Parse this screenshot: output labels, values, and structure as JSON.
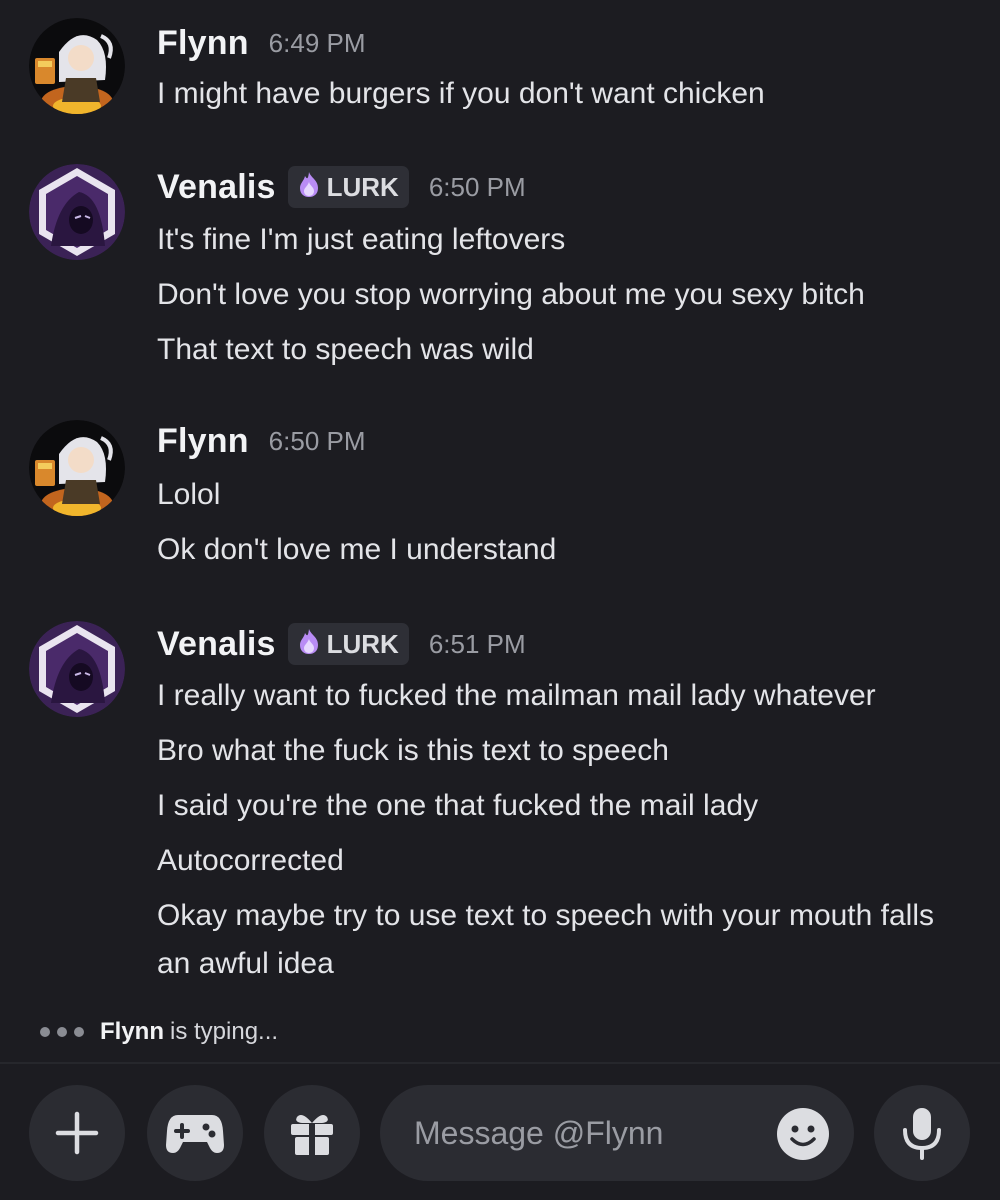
{
  "messages": [
    {
      "username": "Flynn",
      "time": "6:49 PM",
      "lines": [
        "I might have burgers if you don't want chicken"
      ]
    },
    {
      "username": "Venalis",
      "tag": "LURK",
      "time": "6:50 PM",
      "lines": [
        "It's fine I'm just eating leftovers",
        "Don't love you stop worrying about me you sexy bitch",
        "That text to speech was wild"
      ]
    },
    {
      "username": "Flynn",
      "time": "6:50 PM",
      "lines": [
        "Lolol",
        "Ok don't love me I understand"
      ]
    },
    {
      "username": "Venalis",
      "tag": "LURK",
      "time": "6:51 PM",
      "lines": [
        "I really want to fucked the mailman mail lady whatever",
        "Bro what the fuck is this text to speech",
        "I said you're the one that fucked the mail lady",
        "Autocorrected",
        "Okay maybe try to use text to speech with your mouth falls an awful idea"
      ]
    }
  ],
  "typing": {
    "user": "Flynn",
    "text": "is typing..."
  },
  "composer": {
    "placeholder": "Message @Flynn",
    "icons": [
      "plus-icon",
      "gamepad-icon",
      "gift-icon",
      "emoji-icon",
      "microphone-icon"
    ]
  },
  "colors": {
    "background": "#1c1c21",
    "control": "#2b2c32",
    "tag_flame": "#b98cf5"
  }
}
